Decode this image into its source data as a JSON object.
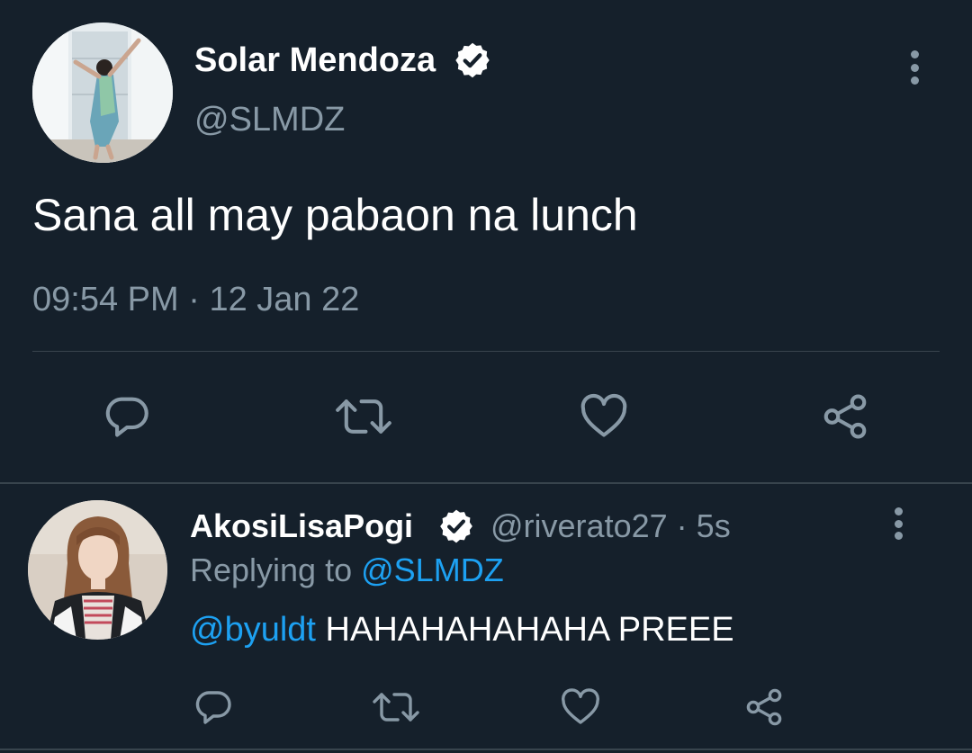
{
  "tweet": {
    "author_name": "Solar Mendoza",
    "author_handle": "@SLMDZ",
    "text": "Sana all may pabaon na lunch",
    "time": "09:54 PM",
    "separator": "·",
    "date": "12 Jan 22"
  },
  "reply": {
    "author_name": "AkosiLisaPogi",
    "author_handle": "@riverato27",
    "separator": "·",
    "time_ago": "5s",
    "replying_to_label": "Replying to",
    "replying_to_handle": "@SLMDZ",
    "mention": "@byuldt",
    "text": " HAHAHAHAHAHA PREEE"
  },
  "icons": {
    "reply": "reply-icon",
    "retweet": "retweet-icon",
    "like": "heart-icon",
    "share": "share-icon",
    "more": "more-vertical-icon",
    "verified": "verified-badge-icon"
  },
  "colors": {
    "background": "#15202b",
    "text": "#ffffff",
    "muted": "#8899a6",
    "link": "#1da1f2",
    "divider": "#38444d"
  }
}
